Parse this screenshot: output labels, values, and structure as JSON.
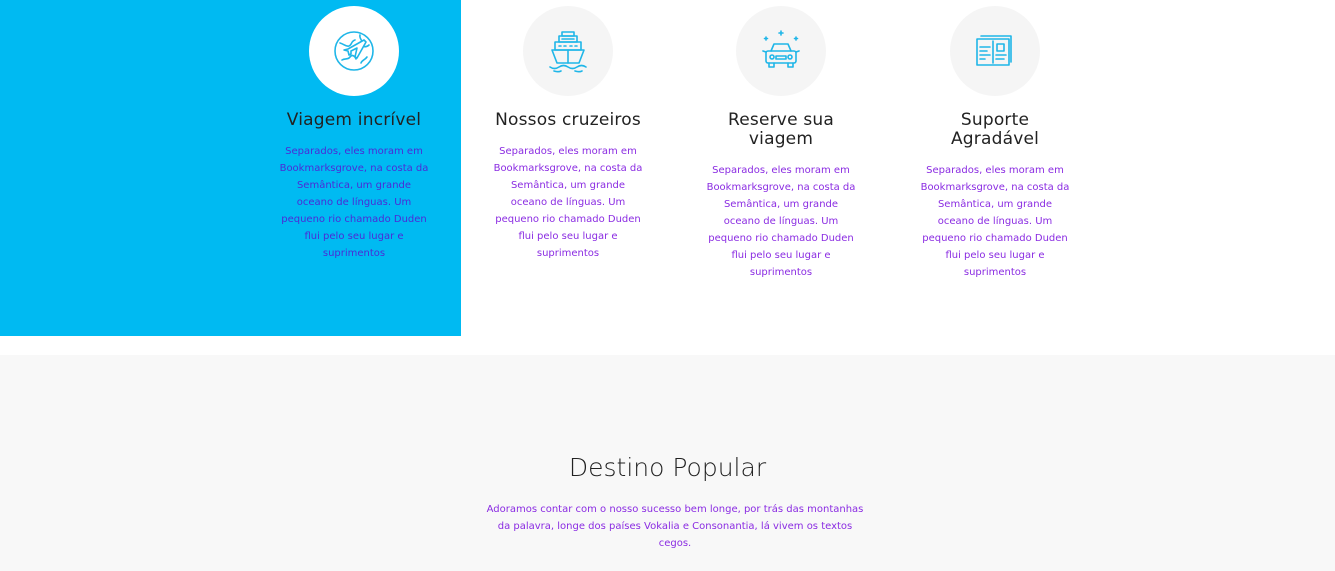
{
  "services": [
    {
      "title": "Viagem incrível",
      "icon": "globe-plane-icon",
      "description": "Separados, eles moram em Bookmarksgrove, na costa da Semântica, um grande oceano de línguas. Um pequeno rio chamado Duden flui pelo seu lugar e suprimentos"
    },
    {
      "title": "Nossos cruzeiros",
      "icon": "cruise-ship-icon",
      "description": "Separados, eles moram em Bookmarksgrove, na costa da Semântica, um grande oceano de línguas. Um pequeno rio chamado Duden flui pelo seu lugar e suprimentos"
    },
    {
      "title": "Reserve sua viagem",
      "icon": "car-icon",
      "description": "Separados, eles moram em Bookmarksgrove, na costa da Semântica, um grande oceano de línguas. Um pequeno rio chamado Duden flui pelo seu lugar e suprimentos"
    },
    {
      "title": "Suporte Agradável",
      "icon": "ticket-icon",
      "description": "Separados, eles moram em Bookmarksgrove, na costa da Semântica, um grande oceano de línguas. Um pequeno rio chamado Duden flui pelo seu lugar e suprimentos"
    }
  ],
  "popular": {
    "title": "Destino Popular",
    "description": "Adoramos contar com o nosso sucesso bem longe, por trás das montanhas da palavra, longe dos países Vokalia e Consonantia, lá vivem os textos cegos."
  },
  "colors": {
    "accent_blue": "#00baf2",
    "icon_blue": "#1fb6e8",
    "text_purple": "#8a2be2"
  }
}
